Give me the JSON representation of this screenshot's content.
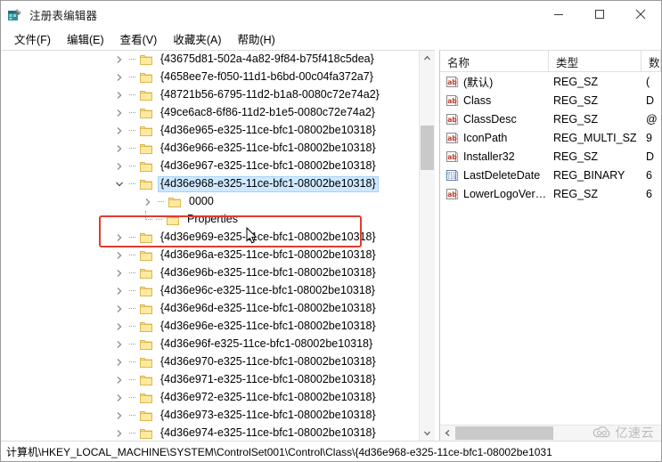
{
  "window": {
    "title": "注册表编辑器",
    "app_icon": "registry-editor-icon",
    "controls": {
      "minimize": "minimize-icon",
      "maximize": "maximize-icon",
      "close": "close-icon"
    }
  },
  "menubar": {
    "items": [
      {
        "label": "文件(F)"
      },
      {
        "label": "编辑(E)"
      },
      {
        "label": "查看(V)"
      },
      {
        "label": "收藏夹(A)"
      },
      {
        "label": "帮助(H)"
      }
    ]
  },
  "tree": {
    "rows": [
      {
        "label": "{43675d81-502a-4a82-9f84-b75f418c5dea}",
        "level": 0,
        "expander": "collapsed",
        "selected": false
      },
      {
        "label": "{4658ee7e-f050-11d1-b6bd-00c04fa372a7}",
        "level": 0,
        "expander": "collapsed",
        "selected": false
      },
      {
        "label": "{48721b56-6795-11d2-b1a8-0080c72e74a2}",
        "level": 0,
        "expander": "collapsed",
        "selected": false
      },
      {
        "label": "{49ce6ac8-6f86-11d2-b1e5-0080c72e74a2}",
        "level": 0,
        "expander": "collapsed",
        "selected": false
      },
      {
        "label": "{4d36e965-e325-11ce-bfc1-08002be10318}",
        "level": 0,
        "expander": "collapsed",
        "selected": false
      },
      {
        "label": "{4d36e966-e325-11ce-bfc1-08002be10318}",
        "level": 0,
        "expander": "collapsed",
        "selected": false
      },
      {
        "label": "{4d36e967-e325-11ce-bfc1-08002be10318}",
        "level": 0,
        "expander": "collapsed",
        "selected": false
      },
      {
        "label": "{4d36e968-e325-11ce-bfc1-08002be10318}",
        "level": 0,
        "expander": "expanded",
        "selected": true
      },
      {
        "label": "0000",
        "level": 1,
        "expander": "collapsed",
        "selected": false
      },
      {
        "label": "Properties",
        "level": 1,
        "expander": "none",
        "selected": false
      },
      {
        "label": "{4d36e969-e325-11ce-bfc1-08002be10318}",
        "level": 0,
        "expander": "collapsed",
        "selected": false
      },
      {
        "label": "{4d36e96a-e325-11ce-bfc1-08002be10318}",
        "level": 0,
        "expander": "collapsed",
        "selected": false
      },
      {
        "label": "{4d36e96b-e325-11ce-bfc1-08002be10318}",
        "level": 0,
        "expander": "collapsed",
        "selected": false
      },
      {
        "label": "{4d36e96c-e325-11ce-bfc1-08002be10318}",
        "level": 0,
        "expander": "collapsed",
        "selected": false
      },
      {
        "label": "{4d36e96d-e325-11ce-bfc1-08002be10318}",
        "level": 0,
        "expander": "collapsed",
        "selected": false
      },
      {
        "label": "{4d36e96e-e325-11ce-bfc1-08002be10318}",
        "level": 0,
        "expander": "collapsed",
        "selected": false
      },
      {
        "label": "{4d36e96f-e325-11ce-bfc1-08002be10318}",
        "level": 0,
        "expander": "collapsed",
        "selected": false
      },
      {
        "label": "{4d36e970-e325-11ce-bfc1-08002be10318}",
        "level": 0,
        "expander": "collapsed",
        "selected": false
      },
      {
        "label": "{4d36e971-e325-11ce-bfc1-08002be10318}",
        "level": 0,
        "expander": "collapsed",
        "selected": false
      },
      {
        "label": "{4d36e972-e325-11ce-bfc1-08002be10318}",
        "level": 0,
        "expander": "collapsed",
        "selected": false
      },
      {
        "label": "{4d36e973-e325-11ce-bfc1-08002be10318}",
        "level": 0,
        "expander": "collapsed",
        "selected": false
      },
      {
        "label": "{4d36e974-e325-11ce-bfc1-08002be10318}",
        "level": 0,
        "expander": "collapsed",
        "selected": false
      }
    ],
    "selection_highlight_color": "#cde8ff",
    "annotation_color": "#e03c31",
    "scrollbar": {
      "up_arrow": "chevron-up-icon",
      "down_arrow": "chevron-down-icon"
    }
  },
  "values": {
    "columns": [
      "名称",
      "类型",
      "数据"
    ],
    "rows": [
      {
        "icon": "string-value-icon",
        "name": "(默认)",
        "type": "REG_SZ",
        "data": "("
      },
      {
        "icon": "string-value-icon",
        "name": "Class",
        "type": "REG_SZ",
        "data": "D"
      },
      {
        "icon": "string-value-icon",
        "name": "ClassDesc",
        "type": "REG_SZ",
        "data": "@"
      },
      {
        "icon": "string-value-icon",
        "name": "IconPath",
        "type": "REG_MULTI_SZ",
        "data": "9"
      },
      {
        "icon": "string-value-icon",
        "name": "Installer32",
        "type": "REG_SZ",
        "data": "D"
      },
      {
        "icon": "binary-value-icon",
        "name": "LastDeleteDate",
        "type": "REG_BINARY",
        "data": "6"
      },
      {
        "icon": "string-value-icon",
        "name": "LowerLogoVer…",
        "type": "REG_SZ",
        "data": "6"
      }
    ],
    "hscroll_left_arrow": "chevron-left-icon"
  },
  "statusbar": {
    "path": "计算机\\HKEY_LOCAL_MACHINE\\SYSTEM\\ControlSet001\\Control\\Class\\{4d36e968-e325-11ce-bfc1-08002be1031"
  },
  "watermark": {
    "icon": "cloud-icon",
    "text": "亿速云"
  }
}
